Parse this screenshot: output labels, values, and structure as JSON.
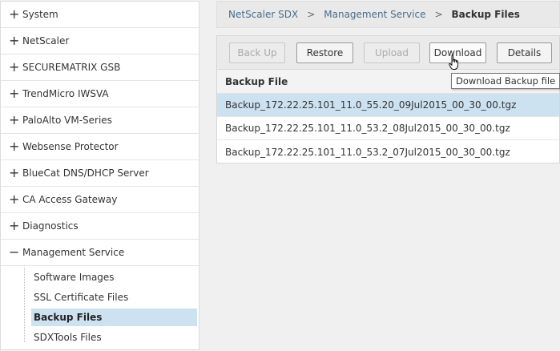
{
  "sidebar": {
    "items": [
      {
        "sign": "+",
        "label": "System"
      },
      {
        "sign": "+",
        "label": "NetScaler"
      },
      {
        "sign": "+",
        "label": "SECUREMATRIX GSB"
      },
      {
        "sign": "+",
        "label": "TrendMicro IWSVA"
      },
      {
        "sign": "+",
        "label": "PaloAlto VM-Series"
      },
      {
        "sign": "+",
        "label": "Websense Protector"
      },
      {
        "sign": "+",
        "label": "BlueCat DNS/DHCP Server"
      },
      {
        "sign": "+",
        "label": "CA Access Gateway"
      },
      {
        "sign": "+",
        "label": "Diagnostics"
      },
      {
        "sign": "−",
        "label": "Management Service"
      }
    ],
    "subitems": [
      {
        "label": "Software Images"
      },
      {
        "label": "SSL Certificate Files"
      },
      {
        "label": "Backup Files"
      },
      {
        "label": "SDXTools Files"
      }
    ]
  },
  "breadcrumb": {
    "items": [
      "NetScaler SDX",
      "Management Service"
    ],
    "separator": ">",
    "current": "Backup Files"
  },
  "toolbar": {
    "back_up": "Back Up",
    "restore": "Restore",
    "upload": "Upload",
    "download": "Download",
    "details": "Details"
  },
  "table": {
    "header": "Backup File",
    "rows": [
      "Backup_172.22.25.101_11.0_55.20_09Jul2015_00_30_00.tgz",
      "Backup_172.22.25.101_11.0_53.2_08Jul2015_00_30_00.tgz",
      "Backup_172.22.25.101_11.0_53.2_07Jul2015_00_30_00.tgz"
    ]
  },
  "tooltip": {
    "text": "Download Backup file"
  },
  "colors": {
    "selection": "#cde2f1",
    "link": "#4a6d8c"
  }
}
